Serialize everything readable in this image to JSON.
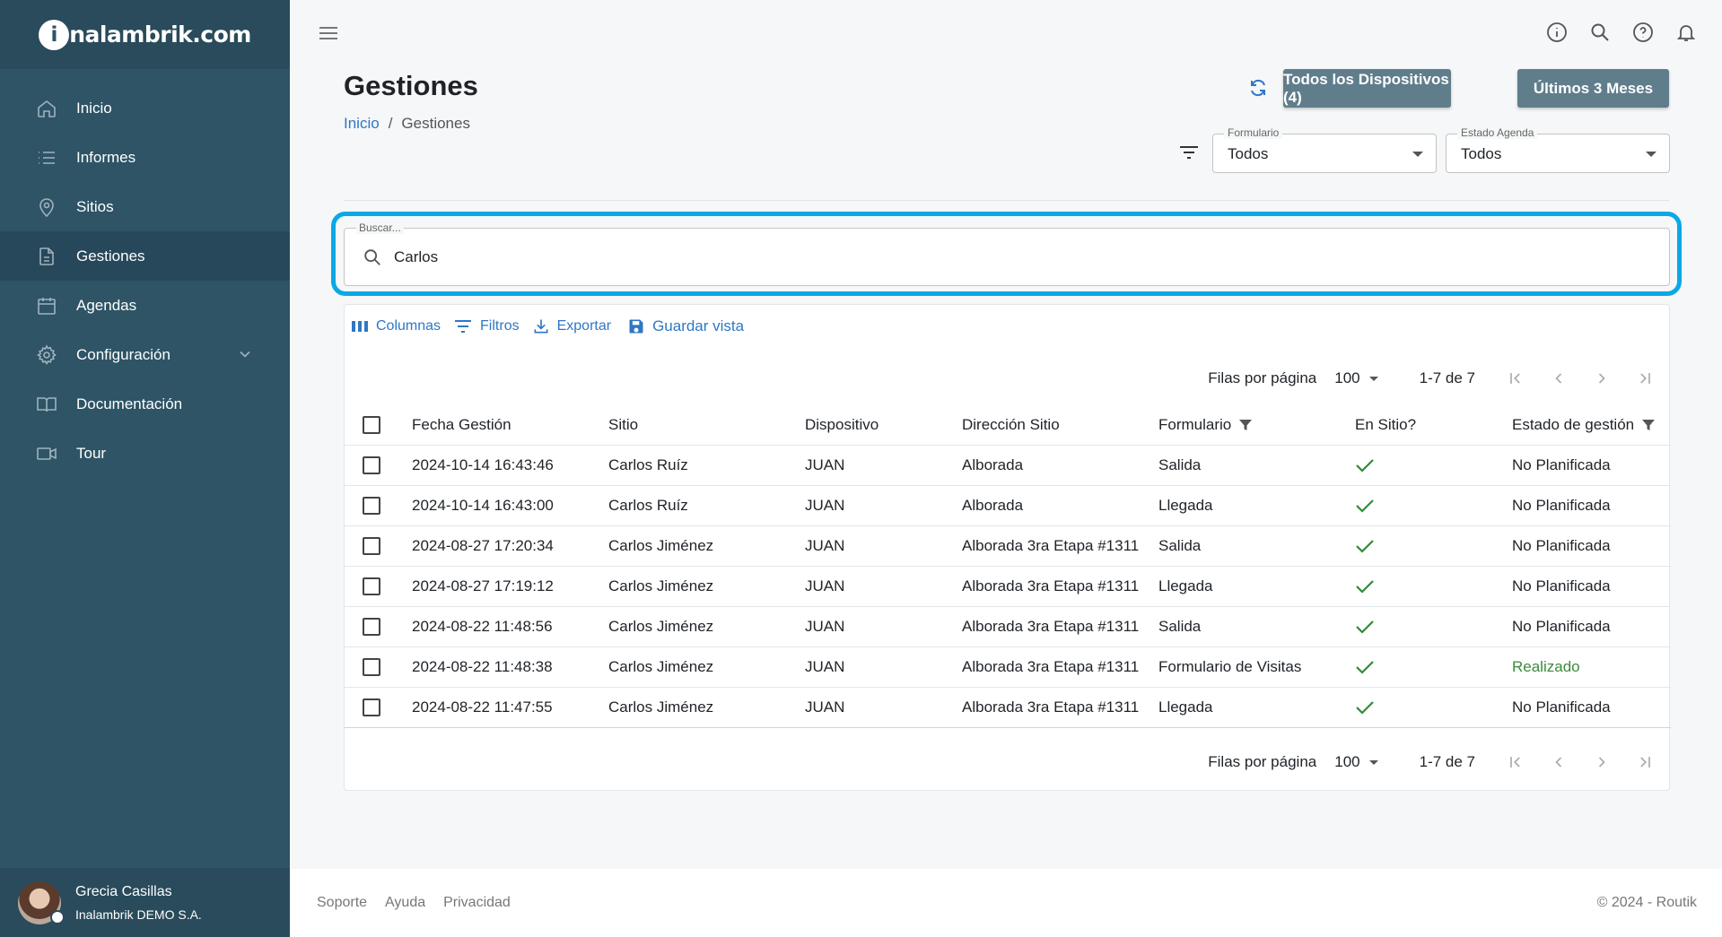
{
  "brand": {
    "logo_letter": "i",
    "logo_text": "nalambrik.com"
  },
  "sidebar": {
    "items": [
      {
        "label": "Inicio",
        "icon": "home-icon"
      },
      {
        "label": "Informes",
        "icon": "list-icon"
      },
      {
        "label": "Sitios",
        "icon": "map-pin-icon"
      },
      {
        "label": "Gestiones",
        "icon": "document-icon",
        "active": true
      },
      {
        "label": "Agendas",
        "icon": "calendar-icon"
      },
      {
        "label": "Configuración",
        "icon": "gear-icon",
        "expandable": true
      },
      {
        "label": "Documentación",
        "icon": "book-icon"
      },
      {
        "label": "Tour",
        "icon": "video-icon"
      }
    ],
    "user": {
      "name": "Grecia Casillas",
      "org": "Inalambrik DEMO S.A."
    }
  },
  "header": {
    "title": "Gestiones",
    "breadcrumb": {
      "home": "Inicio",
      "separator": "/",
      "current": "Gestiones"
    },
    "buttons": {
      "devices": "Todos los Dispositivos (4)",
      "range": "Últimos 3 Meses"
    },
    "filters": {
      "formulario": {
        "label": "Formulario",
        "value": "Todos"
      },
      "estado_agenda": {
        "label": "Estado Agenda",
        "value": "Todos"
      }
    }
  },
  "search": {
    "label": "Buscar...",
    "value": "Carlos"
  },
  "toolbar": {
    "columns": "Columnas",
    "filters": "Filtros",
    "export": "Exportar",
    "save_view": "Guardar vista"
  },
  "pagination": {
    "rows_label": "Filas por página",
    "rows_value": "100",
    "range": "1-7 de 7"
  },
  "table": {
    "columns": [
      "Fecha Gestión",
      "Sitio",
      "Dispositivo",
      "Dirección Sitio",
      "Formulario",
      "En Sitio?",
      "Estado de gestión"
    ],
    "rows": [
      {
        "fecha": "2024-10-14 16:43:46",
        "sitio": "Carlos Ruíz",
        "dispositivo": "JUAN",
        "direccion": "Alborada",
        "formulario": "Salida",
        "estado": "No Planificada"
      },
      {
        "fecha": "2024-10-14 16:43:00",
        "sitio": "Carlos Ruíz",
        "dispositivo": "JUAN",
        "direccion": "Alborada",
        "formulario": "Llegada",
        "estado": "No Planificada"
      },
      {
        "fecha": "2024-08-27 17:20:34",
        "sitio": "Carlos Jiménez",
        "dispositivo": "JUAN",
        "direccion": "Alborada 3ra Etapa #1311",
        "formulario": "Salida",
        "estado": "No Planificada"
      },
      {
        "fecha": "2024-08-27 17:19:12",
        "sitio": "Carlos Jiménez",
        "dispositivo": "JUAN",
        "direccion": "Alborada 3ra Etapa #1311",
        "formulario": "Llegada",
        "estado": "No Planificada"
      },
      {
        "fecha": "2024-08-22 11:48:56",
        "sitio": "Carlos Jiménez",
        "dispositivo": "JUAN",
        "direccion": "Alborada 3ra Etapa #1311",
        "formulario": "Salida",
        "estado": "No Planificada"
      },
      {
        "fecha": "2024-08-22 11:48:38",
        "sitio": "Carlos Jiménez",
        "dispositivo": "JUAN",
        "direccion": "Alborada 3ra Etapa #1311",
        "formulario": "Formulario de Visitas",
        "estado": "Realizado"
      },
      {
        "fecha": "2024-08-22 11:47:55",
        "sitio": "Carlos Jiménez",
        "dispositivo": "JUAN",
        "direccion": "Alborada 3ra Etapa #1311",
        "formulario": "Llegada",
        "estado": "No Planificada"
      }
    ]
  },
  "footer": {
    "links": [
      "Soporte",
      "Ayuda",
      "Privacidad"
    ],
    "copyright": "© 2024 - Routik"
  },
  "colors": {
    "sidebar": "#2e5466",
    "accent": "#2f77c4",
    "button": "#607d8b",
    "highlight": "#0aa8e6",
    "success": "#3b8b3b"
  }
}
